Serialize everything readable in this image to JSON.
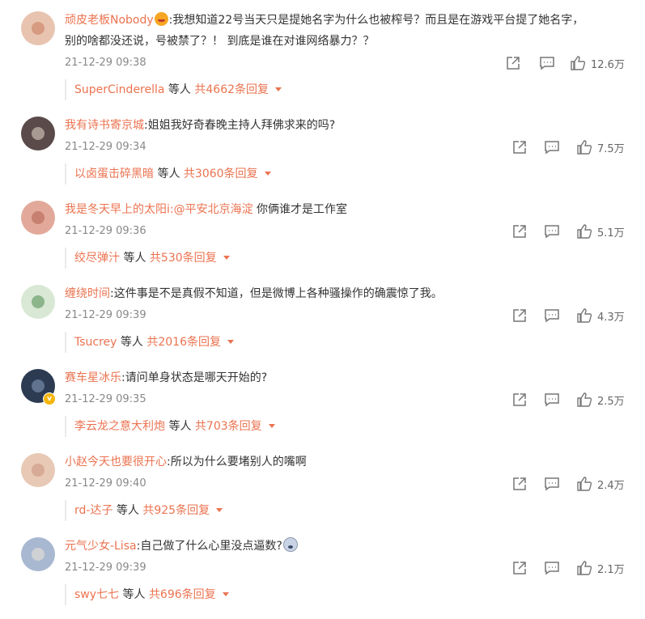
{
  "comments": [
    {
      "username": "顽皮老板Nobody",
      "emoji": "blush-emoji",
      "text_line1": ":我想知道22号当天只是提她名字为什么也被榨号？而且是在游戏平台提了她名字，",
      "text_line2": "别的啥都没还说，号被禁了？！ 到底是谁在对谁网络暴力？？",
      "time": "21-12-29 09:38",
      "likes": "12.6万",
      "reply_user": "SuperCinderella",
      "reply_mid": " 等人 ",
      "reply_count": "共4662条回复",
      "avatar_color": "#e8c4b0"
    },
    {
      "username": "我有诗书寄京城",
      "text_line1": ":姐姐我好奇春晚主持人拜佛求来的吗?",
      "time": "21-12-29 09:34",
      "likes": "7.5万",
      "reply_user": "以卤蛋击碎黑暗",
      "reply_mid": " 等人 ",
      "reply_count": "共3060条回复",
      "avatar_color": "#5a4a4a"
    },
    {
      "username": "我是冬天早上的太阳i",
      "mention": ":@平安北京海淀",
      "text_line1": " 你俩谁才是工作室",
      "time": "21-12-29 09:36",
      "likes": "5.1万",
      "reply_user": "绞尽弹汁",
      "reply_mid": " 等人 ",
      "reply_count": "共530条回复",
      "avatar_color": "#e2a99a"
    },
    {
      "username": "缠绕时间",
      "text_line1": ":这件事是不是真假不知道，但是微博上各种骚操作的确震惊了我。",
      "time": "21-12-29 09:39",
      "likes": "4.3万",
      "reply_user": "Tsucrey",
      "reply_mid": " 等人 ",
      "reply_count": "共2016条回复",
      "avatar_color": "#d9e8d5"
    },
    {
      "username": "赛车星冰乐",
      "text_line1": ":请问单身状态是哪天开始的?",
      "time": "21-12-29 09:35",
      "likes": "2.5万",
      "reply_user": "李云龙之意大利炮",
      "reply_mid": " 等人 ",
      "reply_count": "共703条回复",
      "avatar_color": "#2c3b52"
    },
    {
      "username": "小赵今天也要很开心",
      "text_line1": ":所以为什么要堵别人的嘴啊",
      "time": "21-12-29 09:40",
      "likes": "2.4万",
      "reply_user": "rd-达子",
      "reply_mid": " 等人 ",
      "reply_count": "共925条回复",
      "avatar_color": "#e8c9b5"
    },
    {
      "username": "元气少女-Lisa",
      "text_line1": ":自己做了什么心里没点逼数?",
      "emoji": "cry-emoji",
      "time": "21-12-29 09:39",
      "likes": "2.1万",
      "reply_user": "swy七七",
      "reply_mid": " 等人 ",
      "reply_count": "共696条回复",
      "avatar_color": "#a8b8d0"
    }
  ],
  "icons": {
    "share": "share-icon",
    "comment": "comment-icon",
    "like": "like-icon",
    "expand": "caret-down-icon",
    "verified": "verified-badge-icon"
  },
  "colors": {
    "username": "#eb7350",
    "text": "#333333",
    "time": "#888888"
  }
}
